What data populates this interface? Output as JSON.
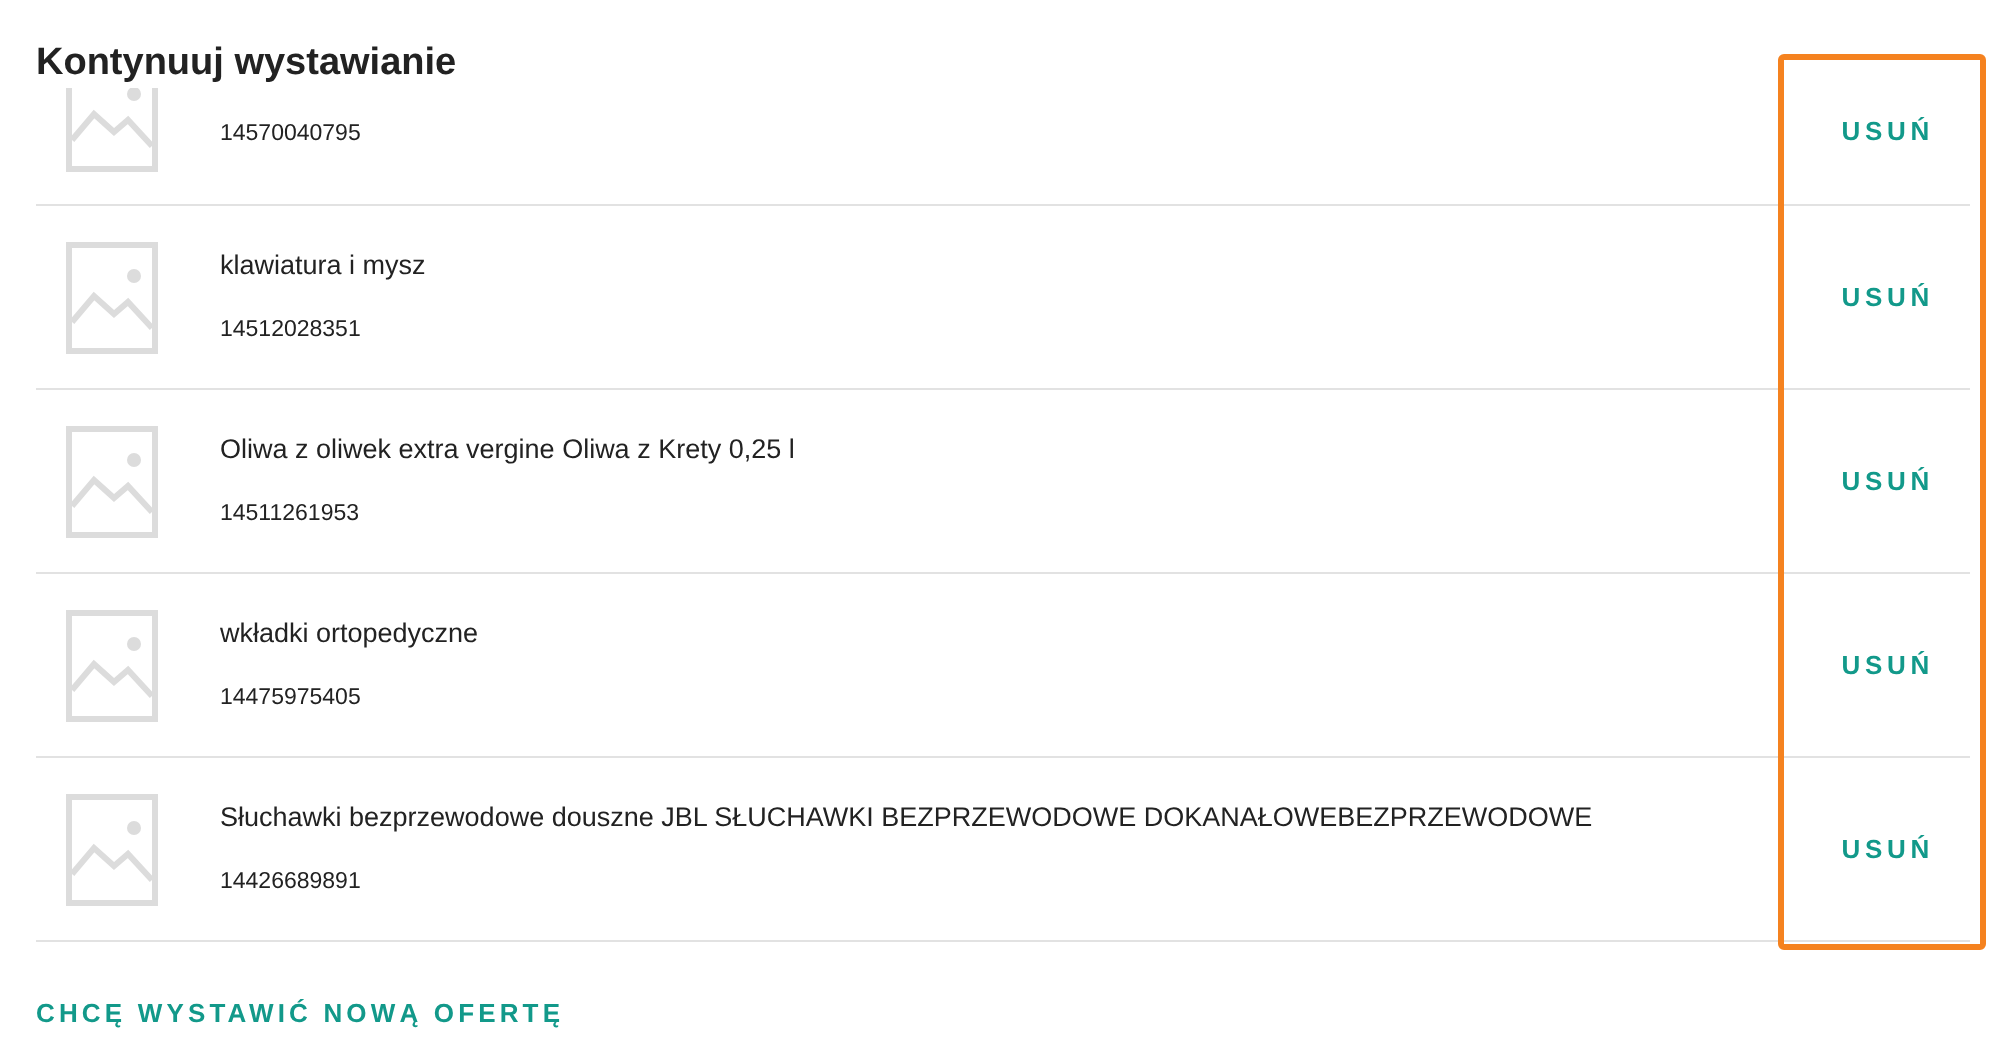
{
  "section_title": "Kontynuuj wystawianie",
  "drafts": [
    {
      "number": "14570040795",
      "remove_label": "USUŃ"
    },
    {
      "title": "klawiatura i mysz",
      "number": "14512028351",
      "remove_label": "USUŃ"
    },
    {
      "title": "Oliwa z oliwek extra vergine Oliwa z Krety 0,25 l",
      "number": "14511261953",
      "remove_label": "USUŃ"
    },
    {
      "title": "wkładki ortopedyczne",
      "number": "14475975405",
      "remove_label": "USUŃ"
    },
    {
      "title": "Słuchawki bezprzewodowe douszne JBL SŁUCHAWKI BEZPRZEWODOWE DOKANAŁOWEBEZPRZEWODOWE",
      "number": "14426689891",
      "remove_label": "USUŃ"
    }
  ],
  "new_offer_link": "CHCĘ WYSTAWIĆ NOWĄ OFERTĘ"
}
